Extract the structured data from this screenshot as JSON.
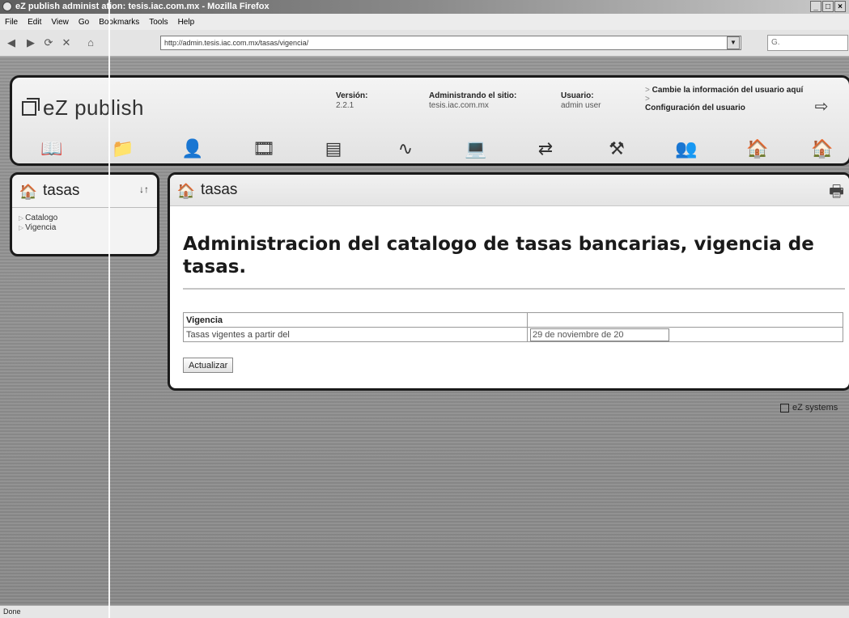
{
  "window": {
    "title": "eZ publish administ ation: tesis.iac.com.mx - Mozilla Firefox",
    "controls": [
      "_",
      "□",
      "×"
    ]
  },
  "menu": [
    "File",
    "Edit",
    "View",
    "Go",
    "Bookmarks",
    "Tools",
    "Help"
  ],
  "nav": {
    "url": "http://admin.tesis.iac.com.mx/tasas/vigencia/",
    "search_placeholder": "G."
  },
  "header": {
    "logo_text": "eZ publish",
    "version_label": "Versión:",
    "version_value": "2.2.1",
    "site_label": "Administrando el sitio:",
    "site_value": "tesis.iac.com.mx",
    "user_label": "Usuario:",
    "user_value": "admin user",
    "change_info": "Cambie la información del usuario aquí",
    "user_config": "Configuración del usuario"
  },
  "toolbar_icons": [
    "book-icon",
    "folder-icon",
    "portrait-icon",
    "film-icon",
    "form-icon",
    "chart-icon",
    "computer-help-icon",
    "arrows-icon",
    "tools-icon",
    "user-icon",
    "house-icon",
    "house-icon-2"
  ],
  "left_panel": {
    "title": "tasas",
    "toggle": "↓↑",
    "items": [
      "Catalogo",
      "Vigencia"
    ]
  },
  "main_panel": {
    "title": "tasas",
    "heading": "Administracion del catalogo de tasas bancarias, vigencia de tasas.",
    "table": {
      "header": "Vigencia",
      "row_label": "Tasas vigentes a partir del",
      "date_value": "29 de noviembre de 20"
    },
    "button": "Actualizar"
  },
  "footer_brand": "eZ systems",
  "status": "Done"
}
